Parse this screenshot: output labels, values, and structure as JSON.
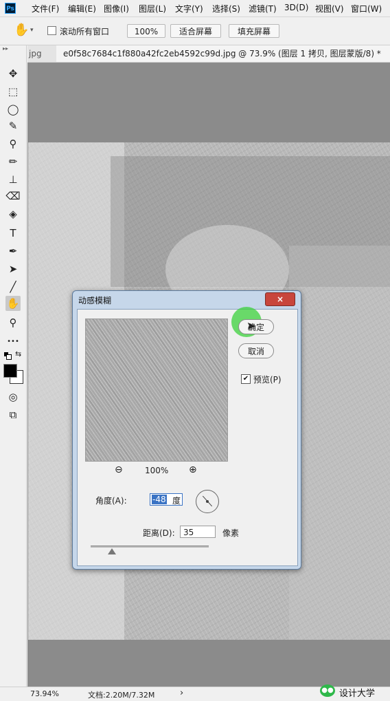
{
  "app": {
    "logo": "Ps"
  },
  "menu": [
    "文件(F)",
    "编辑(E)",
    "图像(I)",
    "图层(L)",
    "文字(Y)",
    "选择(S)",
    "滤镜(T)",
    "3D(D)",
    "视图(V)",
    "窗口(W)"
  ],
  "options": {
    "tool_icon": "hand-icon",
    "scroll_all_label": "滚动所有窗口",
    "scroll_all_checked": false,
    "zoom_value": "100%",
    "fit_screen": "适合屏幕",
    "fill_screen": "填充屏幕"
  },
  "tabs": {
    "prev_tab_label": "jpg",
    "active_tab_label": "e0f58c7684c1f880a42fc2eb4592c99d.jpg @ 73.9% (图层 1 拷贝, 图层蒙版/8) *",
    "close_glyph": "×"
  },
  "toolbar": {
    "collapse_glyph": "▸▸",
    "tools": [
      {
        "name": "move-tool-icon",
        "glyph": "✥"
      },
      {
        "name": "marquee-tool-icon",
        "glyph": "⬚"
      },
      {
        "name": "lasso-tool-icon",
        "glyph": "◯"
      },
      {
        "name": "quick-select-tool-icon",
        "glyph": "✎"
      },
      {
        "name": "eyedropper-tool-icon",
        "glyph": "⚲"
      },
      {
        "name": "brush-tool-icon",
        "glyph": "✏"
      },
      {
        "name": "stamp-tool-icon",
        "glyph": "⊥"
      },
      {
        "name": "eraser-tool-icon",
        "glyph": "⌫"
      },
      {
        "name": "paint-bucket-tool-icon",
        "glyph": "◈"
      },
      {
        "name": "type-tool-icon",
        "glyph": "T"
      },
      {
        "name": "pen-tool-icon",
        "glyph": "✒"
      },
      {
        "name": "path-select-tool-icon",
        "glyph": "➤"
      },
      {
        "name": "line-tool-icon",
        "glyph": "╱"
      },
      {
        "name": "hand-tool-icon",
        "glyph": "✋"
      },
      {
        "name": "zoom-tool-icon",
        "glyph": "⚲"
      },
      {
        "name": "more-tools-icon",
        "glyph": "•••"
      },
      {
        "name": "quick-mask-icon",
        "glyph": "◎"
      },
      {
        "name": "screen-mode-icon",
        "glyph": "⧉"
      }
    ]
  },
  "status": {
    "zoom": "73.94%",
    "doc": "文档:2.20M/7.32M",
    "arrow": "›"
  },
  "dialog": {
    "title": "动感模糊",
    "close": "×",
    "ok": "确定",
    "cancel": "取消",
    "preview_label": "预览(P)",
    "preview_checked": true,
    "zoom_level": "100%",
    "zoom_out": "⊖",
    "zoom_in": "⊕",
    "angle_label": "角度(A):",
    "angle_value": "-48",
    "angle_unit": "度",
    "distance_label": "距离(D):",
    "distance_value": "35",
    "distance_unit": "像素"
  },
  "watermark": {
    "text": "设计大学"
  },
  "colors": {
    "accent": "#3a73c4",
    "dialog_frame": "#c6d7ea",
    "close_red": "#c8463c",
    "canvas_bg": "#8b8b8b"
  }
}
